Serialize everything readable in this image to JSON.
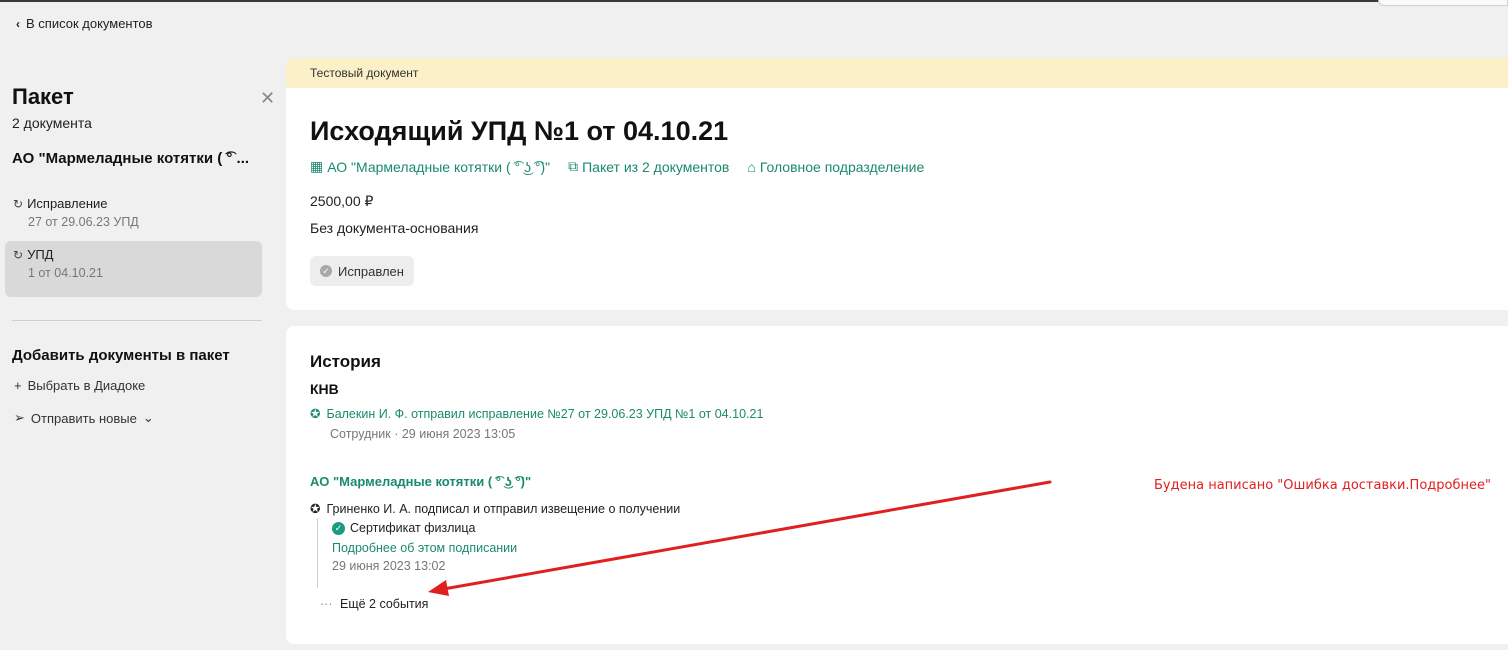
{
  "nav": {
    "back_label": "В список документов"
  },
  "sidebar": {
    "title": "Пакет",
    "count": "2 документа",
    "org": "АО \"Мармеладные котятки ( ͡° ...",
    "docs": [
      {
        "name": "Исправление",
        "sub": "27 от 29.06.23 УПД",
        "icon": "document-forward-icon"
      },
      {
        "name": "УПД",
        "sub": "1 от 04.10.21",
        "icon": "document-forward-icon"
      }
    ],
    "add_title": "Добавить документы в пакет",
    "add_actions": [
      {
        "label": "Выбрать в Диадоке",
        "icon": "plus-icon"
      },
      {
        "label": "Отправить новые",
        "icon": "send-icon"
      }
    ]
  },
  "document": {
    "banner": "Тестовый документ",
    "title": "Исходящий УПД №1 от 04.10.21",
    "org_link": "АО \"Мармеладные котятки ( ͡° ͜ʖ ͡°)\"",
    "package_link": "Пакет из 2 документов",
    "department_link": "Головное подразделение",
    "amount": "2500,00 ₽",
    "basis": "Без документа-основания",
    "status": "Исправлен"
  },
  "history": {
    "title": "История",
    "sender": "КНВ",
    "event1_text": "Балекин И. Ф. отправил исправление №27 от 29.06.23 УПД №1 от 04.10.21",
    "event1_meta": "Сотрудник · 29 июня 2023 13:05",
    "org": "АО \"Мармеладные котятки ( ͡° ͜ʖ ͡°)\"",
    "event2_text": "Гриненко И. А. подписал и отправил извещение о получении",
    "certificate": "Сертификат физлица",
    "signing_link": "Подробнее об этом подписании",
    "event2_date": "29 июня 2023 13:02",
    "more_events": "Ещё 2 события"
  },
  "annotation": {
    "text": "Будена написано \"Ошибка доставки.Подробнее\"",
    "color": "#e02020"
  },
  "colors": {
    "accent": "#1a8a6f",
    "banner_bg": "#fbf0c8",
    "selected_item_bg": "#d9d9d9",
    "page_bg": "#f0f0f0"
  }
}
